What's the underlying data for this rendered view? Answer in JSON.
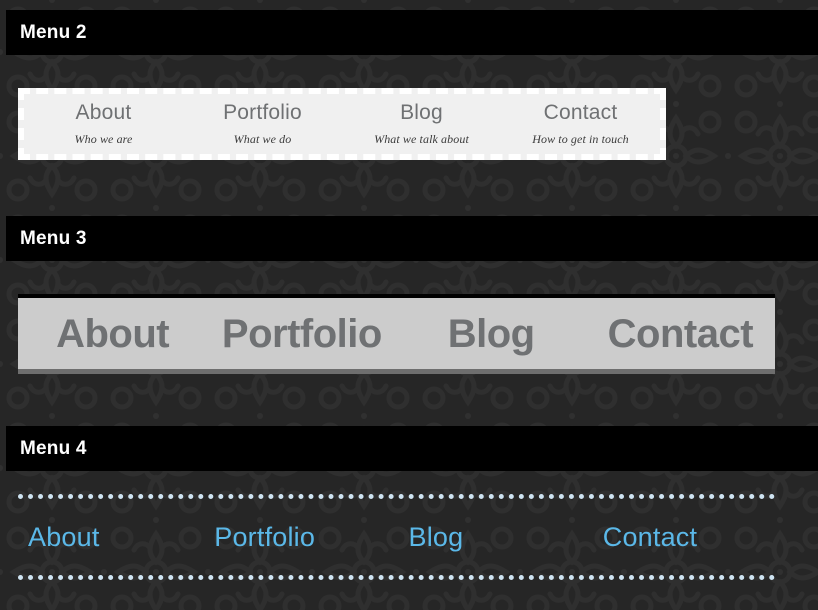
{
  "theme": {
    "page_background": "#262626",
    "header_bar_background": "#000000",
    "header_text_color": "#ffffff",
    "menu2_panel_background": "#f0f0f0",
    "menu2_dash_color": "#ffffff",
    "menu2_label_color": "#6f7173",
    "menu2_sub_color": "#3b3b3b",
    "menu3_panel_background": "#cccccc",
    "menu3_label_color": "#6f7173",
    "menu3_top_border_color": "#000000",
    "menu3_bottom_border_color": "#6e6e6e",
    "menu4_link_color": "#5bb8e8",
    "menu4_dot_color": "#cfe4f2"
  },
  "sections": {
    "menu2": {
      "heading": "Menu 2",
      "items": [
        {
          "label": "About",
          "sub": "Who we are"
        },
        {
          "label": "Portfolio",
          "sub": "What we do"
        },
        {
          "label": "Blog",
          "sub": "What we talk about"
        },
        {
          "label": "Contact",
          "sub": "How to get in touch"
        }
      ]
    },
    "menu3": {
      "heading": "Menu 3",
      "items": [
        {
          "label": "About"
        },
        {
          "label": "Portfolio"
        },
        {
          "label": "Blog"
        },
        {
          "label": "Contact"
        }
      ]
    },
    "menu4": {
      "heading": "Menu 4",
      "items": [
        {
          "label": "About"
        },
        {
          "label": "Portfolio"
        },
        {
          "label": "Blog"
        },
        {
          "label": "Contact"
        }
      ]
    }
  }
}
